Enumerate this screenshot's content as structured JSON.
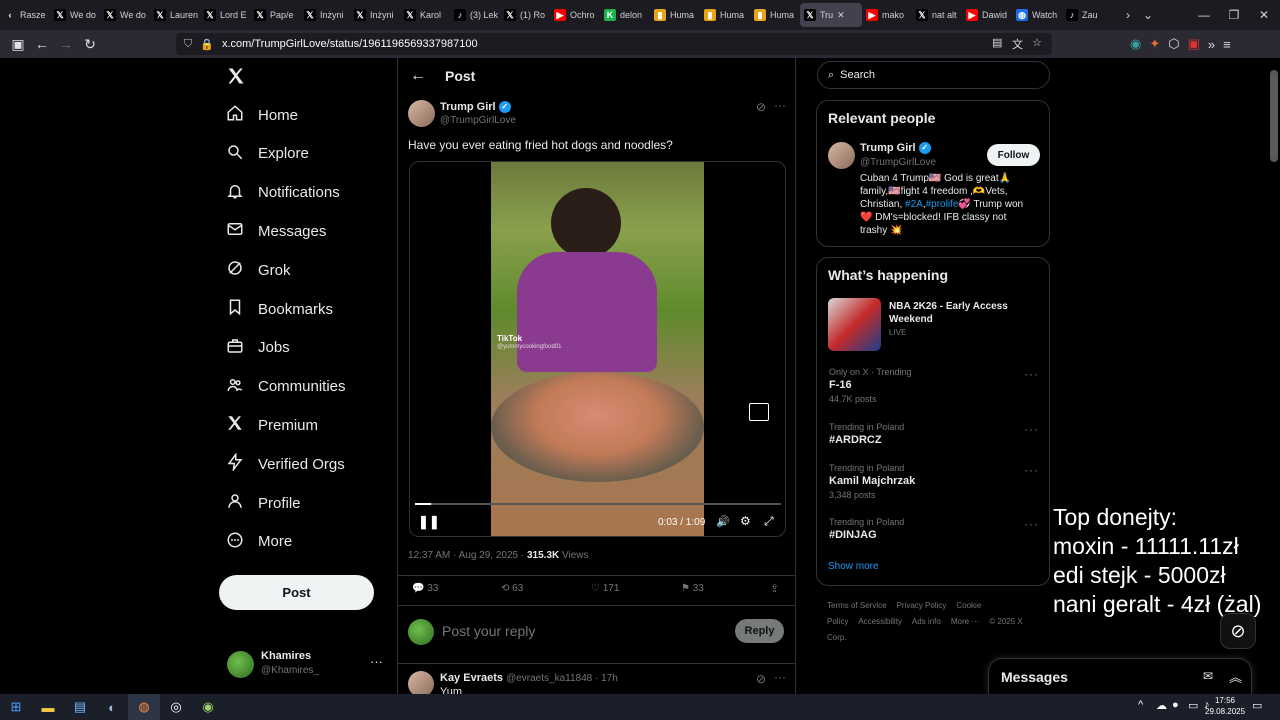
{
  "browser": {
    "tabs": [
      {
        "label": "Rasze",
        "icon": "chevron-left"
      },
      {
        "label": "We do",
        "icon": "x"
      },
      {
        "label": "We do",
        "icon": "x"
      },
      {
        "label": "Lauren",
        "icon": "x"
      },
      {
        "label": "Lord E",
        "icon": "x"
      },
      {
        "label": "Pap/e",
        "icon": "x"
      },
      {
        "label": "Inżyni",
        "icon": "x"
      },
      {
        "label": "Inżyni",
        "icon": "x"
      },
      {
        "label": "Karol",
        "icon": "x"
      },
      {
        "label": "(3) Lek",
        "icon": "tiktok"
      },
      {
        "label": "(1) Ro",
        "icon": "x"
      },
      {
        "label": "Ochro",
        "icon": "youtube"
      },
      {
        "label": "delon",
        "icon": "k"
      },
      {
        "label": "Huma",
        "icon": "bookmark"
      },
      {
        "label": "Huma",
        "icon": "bookmark"
      },
      {
        "label": "Huma",
        "icon": "bookmark"
      },
      {
        "label": "Tru",
        "icon": "x",
        "active": true
      },
      {
        "label": "mako",
        "icon": "youtube"
      },
      {
        "label": "nat alt",
        "icon": "x"
      },
      {
        "label": "Dawid",
        "icon": "youtube"
      },
      {
        "label": "Watch",
        "icon": "globe"
      },
      {
        "label": "Zau",
        "icon": "tiktok"
      }
    ],
    "url": "x.com/TrumpGirlLove/status/1961196569337987100"
  },
  "leftnav": {
    "items": [
      {
        "label": "Home",
        "icon": "home-icon"
      },
      {
        "label": "Explore",
        "icon": "search-icon"
      },
      {
        "label": "Notifications",
        "icon": "bell-icon"
      },
      {
        "label": "Messages",
        "icon": "mail-icon"
      },
      {
        "label": "Grok",
        "icon": "grok-icon"
      },
      {
        "label": "Bookmarks",
        "icon": "bookmark-icon"
      },
      {
        "label": "Jobs",
        "icon": "briefcase-icon"
      },
      {
        "label": "Communities",
        "icon": "people-icon"
      },
      {
        "label": "Premium",
        "icon": "x-logo-icon"
      },
      {
        "label": "Verified Orgs",
        "icon": "bolt-icon"
      },
      {
        "label": "Profile",
        "icon": "person-icon"
      },
      {
        "label": "More",
        "icon": "more-circle-icon"
      }
    ],
    "post_label": "Post",
    "account": {
      "name": "Khamires",
      "handle": "@Khamires_"
    }
  },
  "post": {
    "header_title": "Post",
    "author_name": "Trump Girl",
    "author_handle": "@TrumpGirlLove",
    "text": "Have you ever eating fried hot dogs and noodles?",
    "video": {
      "time": "0:03 / 1:09",
      "progress": 0.045,
      "watermark": "TikTok",
      "watermark_handle": "@yummycookingfood01"
    },
    "meta_time": "12:37 AM · Aug 29, 2025 ·",
    "views_count": "315.3K",
    "views_label": "Views",
    "stats": {
      "replies": "33",
      "reposts": "63",
      "likes": "171",
      "bookmarks": "33"
    },
    "reply_placeholder": "Post your reply",
    "reply_button": "Reply"
  },
  "reply": {
    "name": "Kay Evraets",
    "handle": "@evraets_ka11848 · 17h",
    "text": "Yum"
  },
  "search": {
    "placeholder": "Search"
  },
  "relevant": {
    "title": "Relevant people",
    "name": "Trump Girl",
    "handle": "@TrumpGirlLove",
    "follow": "Follow",
    "bio_1": "Cuban 4 Trump🇺🇸 God is great🙏",
    "bio_2": "family,🇺🇸fight 4 freedom ,🫶Vets,",
    "bio_3a": "Christian, ",
    "bio_3b": "#2A",
    "bio_3c": ",",
    "bio_3d": "#prolife",
    "bio_3e": "💞 Trump won",
    "bio_4": "❤️ DM's=blocked! IFB classy not",
    "bio_5": "trashy 💥"
  },
  "happening": {
    "title": "What’s happening",
    "featured": {
      "title": "NBA 2K26 - Early Access Weekend",
      "status": "LIVE"
    },
    "trends": [
      {
        "context": "Only on X · Trending",
        "name": "F-16",
        "count": "44.7K posts"
      },
      {
        "context": "Trending in Poland",
        "name": "#ARDRCZ",
        "count": ""
      },
      {
        "context": "Trending in Poland",
        "name": "Kamil Majchrzak",
        "count": "3,348 posts"
      },
      {
        "context": "Trending in Poland",
        "name": "#DINJAG",
        "count": ""
      }
    ],
    "show_more": "Show more"
  },
  "footer_links": [
    "Terms of Service",
    "Privacy Policy",
    "Cookie Policy",
    "Accessibility",
    "Ads info",
    "More ···",
    "© 2025 X Corp."
  ],
  "overlay": {
    "line1": "Top donejty:",
    "line2": "moxin - 11111.11zł",
    "line3": "edi stejk - 5000zł",
    "line4": "nani geralt - 4zł (żal)"
  },
  "messages_bar": {
    "title": "Messages"
  },
  "taskbar": {
    "time": "17:56",
    "date": "29.08.2025"
  }
}
